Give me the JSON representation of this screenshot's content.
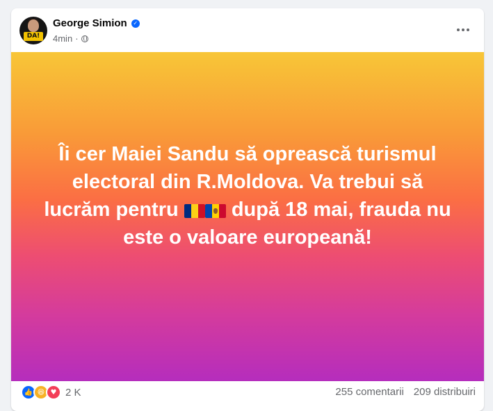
{
  "post": {
    "author": "George Simion",
    "timestamp": "4min",
    "separator": "·",
    "avatar_banner": "DA!",
    "text_line_1": "Îi cer Maiei Sandu să oprească turismul electoral din R.Moldova. Va trebui să lucrăm pentru",
    "text_line_2": "după 18 mai, frauda nu este o valoare europeană!",
    "background_gradient": [
      "#f8c637",
      "#f99a38",
      "#fb6e44",
      "#ed4d72",
      "#d43b9d",
      "#b52dbd"
    ],
    "text_color": "#ffffff",
    "flags": [
      {
        "name": "romania-flag-icon",
        "colors": [
          "#002b7f",
          "#fcd116",
          "#ce1126"
        ]
      },
      {
        "name": "moldova-flag-icon",
        "colors": [
          "#0046ae",
          "#ffd200",
          "#cc092f"
        ]
      }
    ]
  },
  "icons": {
    "verified": "verified-badge-icon",
    "privacy": "globe-icon",
    "more": "more-options-icon",
    "reactions": [
      "like-reaction-icon",
      "haha-reaction-icon",
      "love-reaction-icon"
    ]
  },
  "engagement": {
    "reactions_count": "2 K",
    "comments": "255 comentarii",
    "shares": "209 distribuiri"
  }
}
